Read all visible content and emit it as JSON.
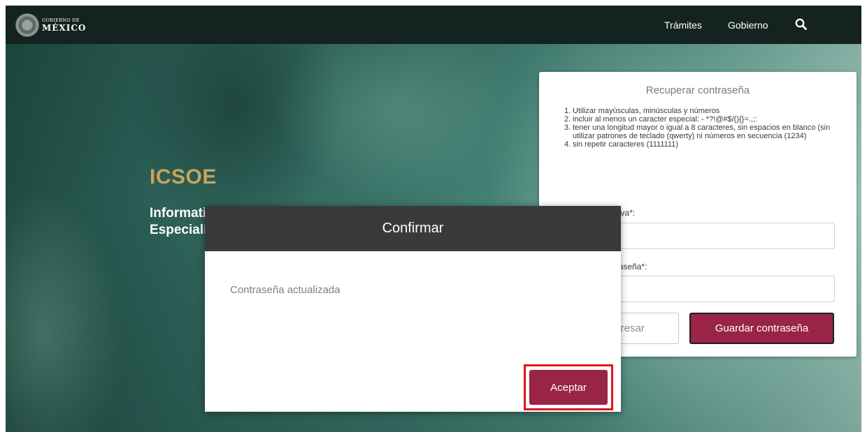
{
  "header": {
    "logo_small": "GOBIERNO DE",
    "logo_big": "MÉXICO",
    "nav": [
      "Trámites",
      "Gobierno"
    ],
    "search_icon": "search-icon"
  },
  "hero": {
    "title": "ICSOE",
    "subtitle": "Informativa de contratos de Servicios u Obras Especializadas"
  },
  "card": {
    "title": "Recuperar contraseña",
    "rules": [
      {
        "num": "1.",
        "text": "Utilizar mayúsculas, minúsculas y números"
      },
      {
        "num": "2.",
        "text": "incluir al menos un caracter especial: - *?!@#$/(){}=.,;:"
      },
      {
        "num": "3.",
        "text": "tener una longitud mayor o igual a 8 caracteres, sin espacios en blanco (sin utilizar patrones de teclado (qwerty) ni números en secuencia (1234)"
      },
      {
        "num": "4.",
        "text": "sin repetir caracteres (1111111)"
      }
    ],
    "new_password_label": "Contraseña nueva*:",
    "new_password_value": "•••••••••••••",
    "confirm_password_label": "Confirmar contraseña*:",
    "confirm_password_value": "",
    "back_button": "Regresar",
    "save_button": "Guardar contraseña"
  },
  "modal": {
    "title": "Confirmar",
    "message": "Contraseña actualizada",
    "accept_button": "Aceptar"
  },
  "colors": {
    "header_bg": "#14231f",
    "accent_wine": "#9a2348",
    "gold": "#c9a45c",
    "highlight_red": "#e3141b",
    "modal_header": "#393b3b"
  }
}
